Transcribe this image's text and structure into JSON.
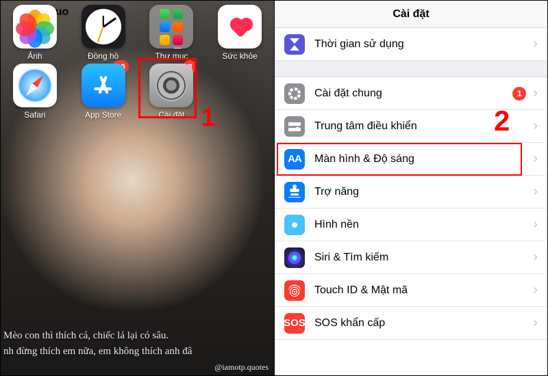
{
  "left": {
    "status_text": "quo",
    "apps_row1": [
      {
        "name": "photos",
        "label": "Ảnh"
      },
      {
        "name": "clock",
        "label": "Đồng hồ"
      },
      {
        "name": "folder",
        "label": "Thư mục"
      },
      {
        "name": "health",
        "label": "Sức khỏe"
      }
    ],
    "apps_row2": [
      {
        "name": "safari",
        "label": "Safari"
      },
      {
        "name": "appstore",
        "label": "App Store",
        "badge": "10"
      },
      {
        "name": "settings",
        "label": "Cài đặt",
        "badge": "3"
      }
    ],
    "caption_line1": "Mèo con thì thích cá, chiếc lá lại có sâu.",
    "caption_line2": "nh đừng thích em nữa, em không thích anh đâ",
    "credit": "@iamotp.quotes",
    "annotation": "1"
  },
  "right": {
    "title": "Cài đặt",
    "group_screentime": [
      {
        "key": "screentime",
        "label": "Thời gian sử dụng"
      }
    ],
    "group_main": [
      {
        "key": "general",
        "label": "Cài đặt chung",
        "badge": "1"
      },
      {
        "key": "controlcenter",
        "label": "Trung tâm điều khiển"
      },
      {
        "key": "display",
        "label": "Màn hình & Độ sáng"
      },
      {
        "key": "accessibility",
        "label": "Trợ năng"
      },
      {
        "key": "wallpaper",
        "label": "Hình nền"
      },
      {
        "key": "siri",
        "label": "Siri & Tìm kiếm"
      },
      {
        "key": "touchid",
        "label": "Touch ID & Mật mã"
      },
      {
        "key": "sos",
        "label": "SOS khẩn cấp"
      }
    ],
    "annotation": "2"
  },
  "colors": {
    "annotation": "#ff0000",
    "badge": "#ff3b30"
  }
}
